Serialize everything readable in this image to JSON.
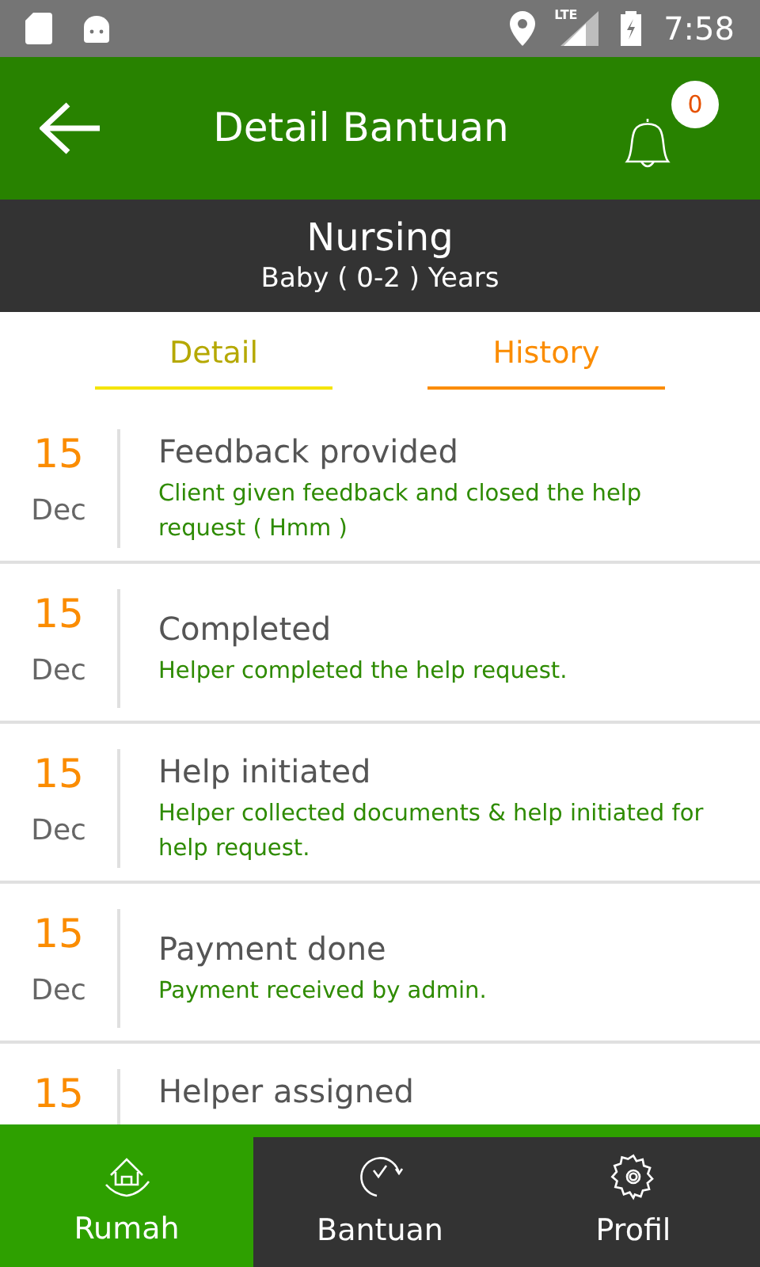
{
  "status_bar": {
    "network": "LTE",
    "time": "7:58"
  },
  "header": {
    "title": "Detail Bantuan",
    "notification_count": "0"
  },
  "subheader": {
    "title": "Nursing",
    "subtitle": "Baby ( 0-2 ) Years"
  },
  "tabs": [
    {
      "label": "Detail",
      "selected": false
    },
    {
      "label": "History",
      "selected": true
    }
  ],
  "history": [
    {
      "day": "15",
      "month": "Dec",
      "title": "Feedback provided",
      "description": "Client given feedback and closed the help request ( Hmm )"
    },
    {
      "day": "15",
      "month": "Dec",
      "title": "Completed",
      "description": "Helper completed the help request."
    },
    {
      "day": "15",
      "month": "Dec",
      "title": "Help initiated",
      "description": "Helper collected documents & help initiated for help request."
    },
    {
      "day": "15",
      "month": "Dec",
      "title": "Payment done",
      "description": "Payment received by admin."
    },
    {
      "day": "15",
      "title": "Helper assigned"
    }
  ],
  "bottom_nav": [
    {
      "label": "Rumah",
      "kind": "home",
      "selected": true
    },
    {
      "label": "Bantuan",
      "kind": "clock",
      "selected": false
    },
    {
      "label": "Profil",
      "kind": "gear",
      "selected": false
    }
  ]
}
